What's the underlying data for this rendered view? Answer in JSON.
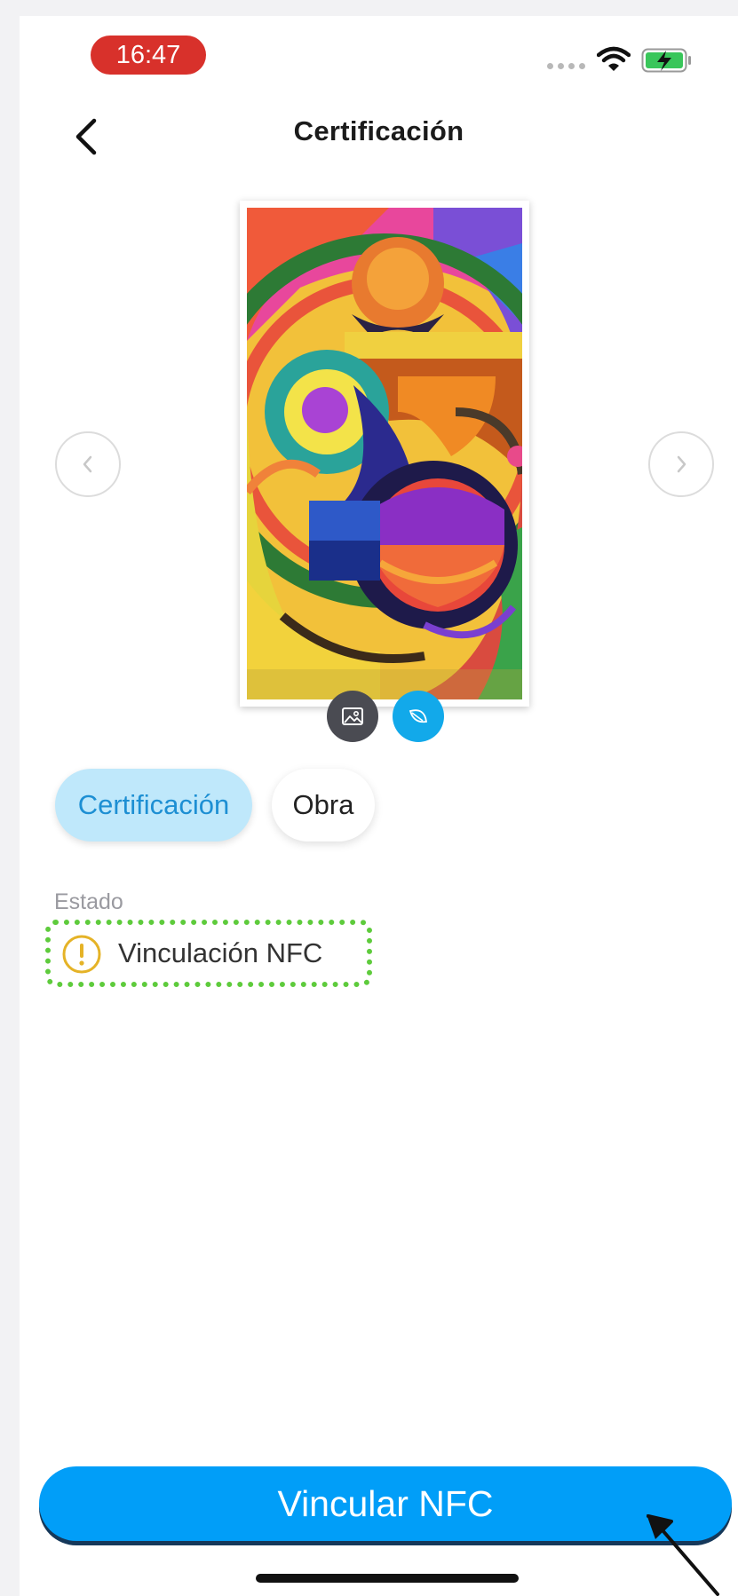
{
  "status_bar": {
    "time": "16:47"
  },
  "header": {
    "title": "Certificación"
  },
  "tabs": [
    {
      "label": "Certificación",
      "active": true
    },
    {
      "label": "Obra",
      "active": false
    }
  ],
  "status_section": {
    "label": "Estado",
    "items": [
      {
        "text": "Vinculación NFC",
        "icon": "warning-icon"
      }
    ]
  },
  "primary_button": {
    "label": "Vincular NFC"
  },
  "colors": {
    "accent": "#019ef8",
    "tab_active_bg": "#bfe8fb",
    "tab_active_text": "#1d8fd3",
    "warning": "#e5b327",
    "highlight_border": "#5ecb3c",
    "time_pill": "#d8312b"
  },
  "icons": [
    "back-arrow-icon",
    "chevron-left-icon",
    "chevron-right-icon",
    "image-icon",
    "leaf-icon",
    "warning-icon",
    "wifi-icon",
    "battery-charging-icon"
  ]
}
